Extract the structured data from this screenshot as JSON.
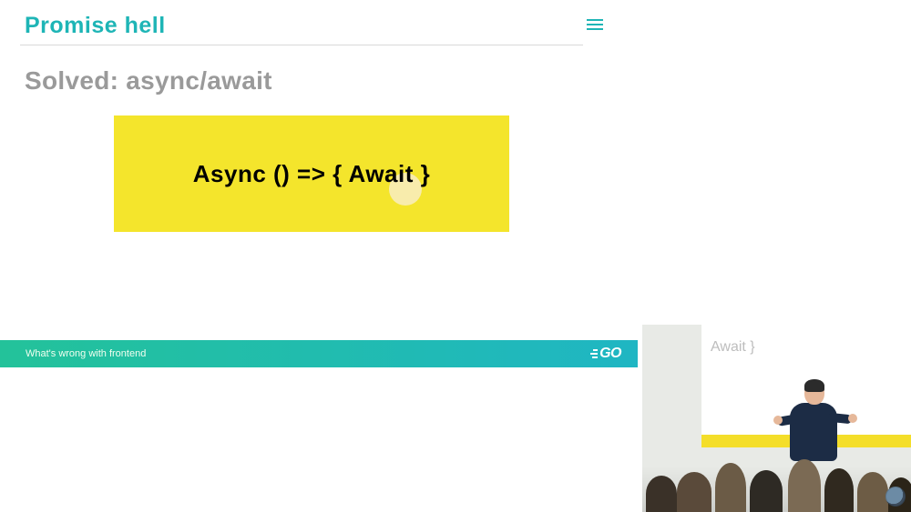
{
  "slide": {
    "title": "Promise hell",
    "subtitle": "Solved: async/await",
    "code_snippet": "Async () => { Await }"
  },
  "footer": {
    "talk_title": "What's wrong with frontend",
    "logo_text": "GO"
  },
  "pip": {
    "projected_text": "Await }"
  }
}
